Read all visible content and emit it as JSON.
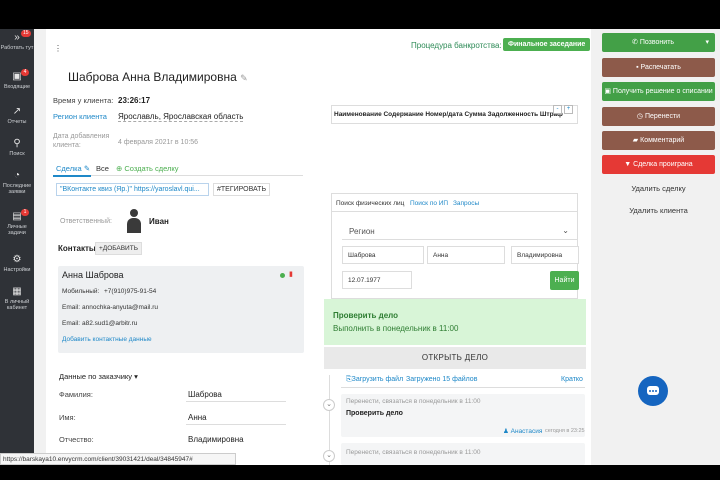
{
  "sidebar": {
    "items": [
      {
        "label": "Работать тут",
        "icon": "double-chevron-icon",
        "badge": "15"
      },
      {
        "label": "Входящие",
        "icon": "inbox-icon",
        "badge": "4"
      },
      {
        "label": "Отчеты",
        "icon": "chart-icon",
        "badge": ""
      },
      {
        "label": "Поиск",
        "icon": "search-icon",
        "badge": ""
      },
      {
        "label": "Последние заявки",
        "icon": "history-icon",
        "badge": ""
      },
      {
        "label": "Личные задачи",
        "icon": "tasks-icon",
        "badge": "1"
      },
      {
        "label": "Настройки",
        "icon": "gear-icon",
        "badge": ""
      },
      {
        "label": "В личный кабинет",
        "icon": "cabinet-icon",
        "badge": ""
      }
    ]
  },
  "header": {
    "procedure_label": "Процедура банкротства:",
    "stage_badge": "Финальное заседание"
  },
  "client": {
    "name": "Шаброва Анна Владимировна",
    "time_label": "Время у клиента:",
    "time_value": "23:26:17",
    "region_label": "Регион клиента",
    "region_value": "Ярославль, Ярославская область",
    "added_label": "Дата добавления клиента:",
    "added_value": "4 февраля 2021г в 10:56"
  },
  "tabs": {
    "deal": "Сделка",
    "all": "Все",
    "create": "Создать сделку"
  },
  "tags": {
    "source": "\"ВКонтакте квиз (Яр.)\" https://yaroslavl.qui...",
    "tag_button": "#ТЕГИРОВАТЬ"
  },
  "responsible": {
    "label": "Ответственный:",
    "name": "Иван"
  },
  "contacts": {
    "title": "Контакты",
    "add_label": "+ДОБАВИТЬ",
    "card": {
      "name": "Анна Шаброва",
      "mobile_label": "Мобильный:",
      "mobile_value": "+7(910)975-91-54",
      "email1_label": "Email:",
      "email1_value": "annochka-anyuta@mail.ru",
      "email2_label": "Email:",
      "email2_value": "a82.sud1@arbitr.ru",
      "add_contact_link": "Добавить контактные данные"
    }
  },
  "customer": {
    "section_title": "Данные по заказчику ▾",
    "fields": [
      {
        "label": "Фамилия:",
        "value": "Шаброва"
      },
      {
        "label": "Имя:",
        "value": "Анна"
      },
      {
        "label": "Отчество:",
        "value": "Владимировна"
      }
    ]
  },
  "debt_table": {
    "columns": "Наименование  Содержание  Номер/дата  Сумма  Задолженность  Штраф"
  },
  "search": {
    "tabs": [
      "Поиск физических лиц",
      "Поиск по ИП",
      "Запросы"
    ],
    "region_placeholder": "Регион",
    "last_name": "Шаброва",
    "first_name": "Анна",
    "middle_name": "Владимировна",
    "birth_date": "12.07.1977",
    "find_label": "Найти"
  },
  "task": {
    "title": "Проверить дело",
    "due": "Выполнить в понедельник в 11:00"
  },
  "open_deal_label": "ОТКРЫТЬ ДЕЛО",
  "feed": {
    "upload_label": "Загрузить файл",
    "uploaded_label": "Загружено 15 файлов",
    "brief_label": "Кратко",
    "entries": [
      {
        "note": "Перенести, связаться в понедельник в 11:00",
        "text": "Проверить дело",
        "author": "Анастасия",
        "time": "сегодня в 23:25"
      },
      {
        "note": "Перенести, связаться в понедельник в 11:00"
      }
    ]
  },
  "actions": {
    "call": "Позвонить",
    "print": "Распечатать",
    "get_decision": "Получить решение о списании",
    "reschedule": "Перенести",
    "comment": "Комментарий",
    "lost": "Сделка проиграна",
    "delete_deal": "Удалить сделку",
    "delete_client": "Удалить клиента"
  },
  "status_url": "https://barskaya10.envycrm.com/client/39031421/deal/34845947#",
  "colors": {
    "sidebar": "#2f3237",
    "green": "#4caf50",
    "red": "#e53935",
    "brown": "#8d5a4a",
    "link": "#1e88c8"
  }
}
